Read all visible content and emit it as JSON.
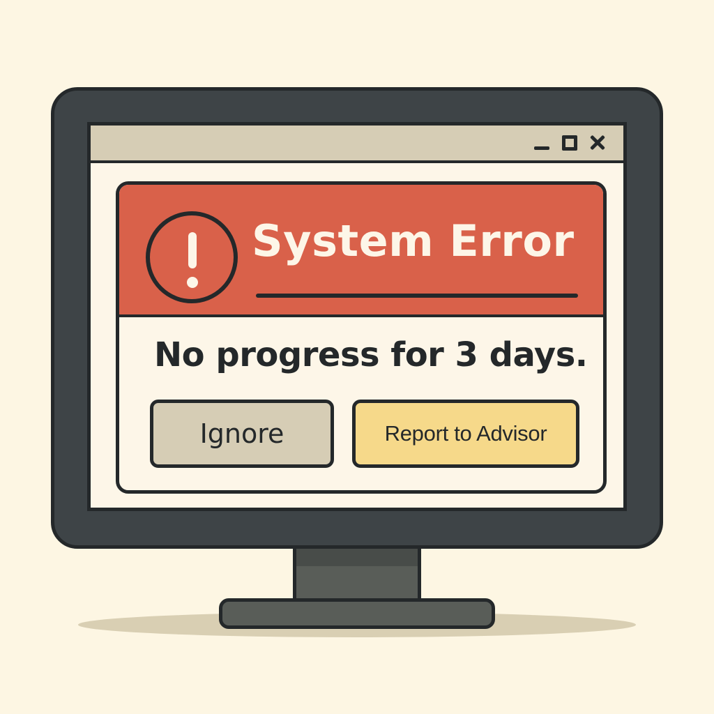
{
  "dialog": {
    "title": "System Error",
    "message": "No progress for 3 days.",
    "buttons": {
      "ignore": "Ignore",
      "report": "Report to Advisor"
    }
  },
  "icons": {
    "alert": "exclamation-circle-icon",
    "minimize": "minimize-icon",
    "maximize": "maximize-icon",
    "close": "close-icon"
  },
  "colors": {
    "background": "#fdf6e3",
    "header": "#d9614a",
    "ignore_button": "#d6cdb5",
    "report_button": "#f6d98a",
    "outline": "#24282a",
    "monitor_bezel": "#3e4447"
  }
}
